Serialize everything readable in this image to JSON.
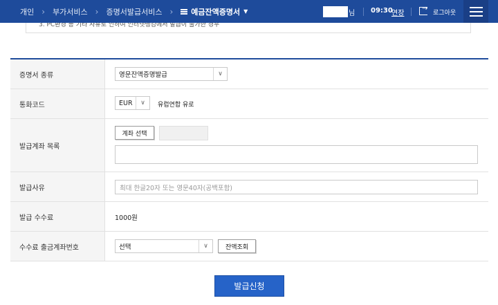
{
  "nav": {
    "breadcrumbs": [
      "개인",
      "부가서비스",
      "증명서발급서비스"
    ],
    "current": "예금잔액증명서",
    "user_suffix": "님",
    "time": "09:30",
    "extend_label": "연장",
    "logout_label": "로그아웃"
  },
  "notice": {
    "text": "3. PC환경 등 기타 사유로 인하여 인터넷뱅킹에서 발급이 불가한 경우"
  },
  "form": {
    "cert_type": {
      "label": "증명서 종류",
      "value": "영문잔액증명발급"
    },
    "currency": {
      "label": "통화코드",
      "value": "EUR",
      "desc": "유럽연합 유로"
    },
    "accounts": {
      "label": "발급계좌 목록",
      "select_button": "계좌 선택"
    },
    "reason": {
      "label": "발급사유",
      "placeholder": "최대 한글20자 또는 영문40자(공백포함)"
    },
    "fee": {
      "label": "발급 수수료",
      "value": "1000원"
    },
    "fee_account": {
      "label": "수수료 출금계좌번호",
      "value": "선택",
      "balance_button": "잔액조회"
    }
  },
  "submit_label": "발급신청",
  "colors": {
    "nav_bg": "#1e4b9b",
    "primary_button": "#2663c8"
  }
}
